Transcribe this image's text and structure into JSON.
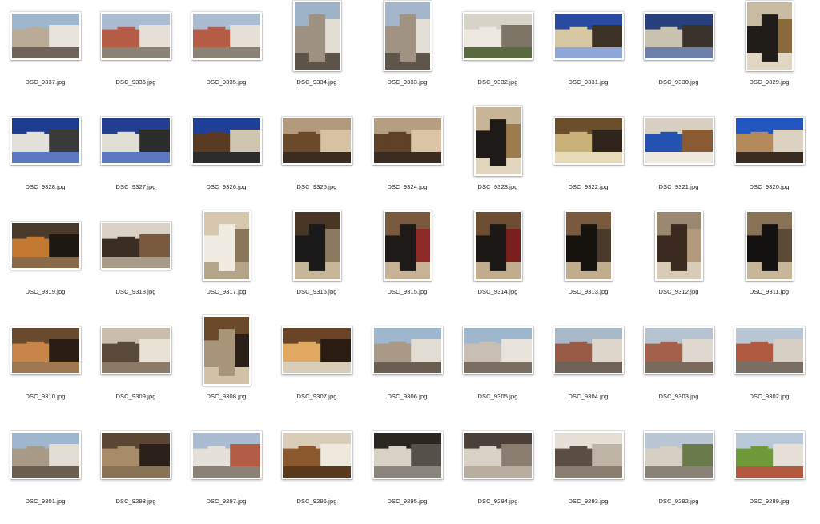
{
  "files": [
    {
      "name": "DSC_9337.jpg",
      "orientation": "landscape",
      "palette": [
        "#9fb6cf",
        "#b9ab95",
        "#e8e4dc",
        "#6e6459"
      ]
    },
    {
      "name": "DSC_9336.jpg",
      "orientation": "landscape",
      "palette": [
        "#a9bcd2",
        "#b45c45",
        "#e6e0d6",
        "#8b8276"
      ]
    },
    {
      "name": "DSC_9335.jpg",
      "orientation": "landscape",
      "palette": [
        "#a9bcd2",
        "#b45c45",
        "#e6e0d6",
        "#8b8276"
      ]
    },
    {
      "name": "DSC_9334.jpg",
      "orientation": "portrait",
      "palette": [
        "#9fb3c8",
        "#9d9181",
        "#e2ddd3",
        "#5c5349"
      ]
    },
    {
      "name": "DSC_9333.jpg",
      "orientation": "portrait",
      "palette": [
        "#a3b6cb",
        "#a09382",
        "#e4dfd6",
        "#5e554b"
      ]
    },
    {
      "name": "DSC_9332.jpg",
      "orientation": "landscape",
      "palette": [
        "#d8d3c8",
        "#ece8e0",
        "#7d7565",
        "#5a6b3f"
      ]
    },
    {
      "name": "DSC_9331.jpg",
      "orientation": "landscape",
      "palette": [
        "#2a4aa0",
        "#d7c7a2",
        "#3c3226",
        "#8fa6d6"
      ]
    },
    {
      "name": "DSC_9330.jpg",
      "orientation": "landscape",
      "palette": [
        "#28407e",
        "#c9c2b0",
        "#3a342c",
        "#6b7fa8"
      ]
    },
    {
      "name": "DSC_9329.jpg",
      "orientation": "portrait",
      "palette": [
        "#c9bba2",
        "#1f1c19",
        "#8a6a3a",
        "#e2d7c2"
      ]
    },
    {
      "name": "DSC_9328.jpg",
      "orientation": "landscape",
      "palette": [
        "#1e3d8f",
        "#e2e0d8",
        "#3a3a3a",
        "#5b78c0"
      ]
    },
    {
      "name": "DSC_9327.jpg",
      "orientation": "landscape",
      "palette": [
        "#22408f",
        "#e0ddd3",
        "#2c2c2c",
        "#5b78c0"
      ]
    },
    {
      "name": "DSC_9326.jpg",
      "orientation": "landscape",
      "palette": [
        "#1f4096",
        "#5a3b22",
        "#d0c6b0",
        "#2c2c2c"
      ]
    },
    {
      "name": "DSC_9325.jpg",
      "orientation": "landscape",
      "palette": [
        "#b49a7c",
        "#6a4a2a",
        "#d7c2a3",
        "#3a2c20"
      ]
    },
    {
      "name": "DSC_9324.jpg",
      "orientation": "landscape",
      "palette": [
        "#b69e80",
        "#5e4127",
        "#d9c4a6",
        "#3a2c20"
      ]
    },
    {
      "name": "DSC_9323.jpg",
      "orientation": "portrait",
      "palette": [
        "#c8b597",
        "#1d1a17",
        "#9c7b4e",
        "#e3d6bf"
      ]
    },
    {
      "name": "DSC_9322.jpg",
      "orientation": "landscape",
      "palette": [
        "#6b4f2c",
        "#c9b27a",
        "#2e241a",
        "#e8dcb8"
      ]
    },
    {
      "name": "DSC_9321.jpg",
      "orientation": "landscape",
      "palette": [
        "#d6cfc2",
        "#2452b0",
        "#8a5a33",
        "#ede9e1"
      ]
    },
    {
      "name": "DSC_9320.jpg",
      "orientation": "landscape",
      "palette": [
        "#2456c0",
        "#b48a5a",
        "#dbd2c2",
        "#3a2c20"
      ]
    },
    {
      "name": "DSC_9319.jpg",
      "orientation": "landscape",
      "palette": [
        "#4a3a2c",
        "#c27a33",
        "#1e1812",
        "#8a6a48"
      ]
    },
    {
      "name": "DSC_9318.jpg",
      "orientation": "landscape",
      "palette": [
        "#d8d1c4",
        "#3a2e24",
        "#7a5a3e",
        "#a89a86"
      ]
    },
    {
      "name": "DSC_9317.jpg",
      "orientation": "portrait",
      "palette": [
        "#d6c8ae",
        "#f1ece2",
        "#8a7658",
        "#b5a588"
      ]
    },
    {
      "name": "DSC_9316.jpg",
      "orientation": "portrait",
      "palette": [
        "#4a3624",
        "#1a1a1a",
        "#8c7a60",
        "#c9b79a"
      ]
    },
    {
      "name": "DSC_9315.jpg",
      "orientation": "portrait",
      "palette": [
        "#7a5a3e",
        "#1e1a18",
        "#8c2a2a",
        "#c7b295"
      ]
    },
    {
      "name": "DSC_9314.jpg",
      "orientation": "portrait",
      "palette": [
        "#6e4e32",
        "#1c1816",
        "#7a1e1e",
        "#c2ac8e"
      ]
    },
    {
      "name": "DSC_9313.jpg",
      "orientation": "portrait",
      "palette": [
        "#7a5a3e",
        "#16130f",
        "#4a3a2a",
        "#c2ac8e"
      ]
    },
    {
      "name": "DSC_9312.jpg",
      "orientation": "portrait",
      "palette": [
        "#9a8870",
        "#3a2a20",
        "#b49a7c",
        "#d9ccb6"
      ]
    },
    {
      "name": "DSC_9311.jpg",
      "orientation": "portrait",
      "palette": [
        "#8a7256",
        "#141210",
        "#5a4a36",
        "#c8b698"
      ]
    },
    {
      "name": "DSC_9310.jpg",
      "orientation": "landscape",
      "palette": [
        "#6a4a2e",
        "#c8854a",
        "#2a1e14",
        "#a07850"
      ]
    },
    {
      "name": "DSC_9309.jpg",
      "orientation": "landscape",
      "palette": [
        "#c9beac",
        "#5a4a3a",
        "#e8e2d6",
        "#8a7a66"
      ]
    },
    {
      "name": "DSC_9308.jpg",
      "orientation": "portrait",
      "palette": [
        "#6a4a2a",
        "#a8957a",
        "#2a2018",
        "#d2c3a6"
      ]
    },
    {
      "name": "DSC_9307.jpg",
      "orientation": "landscape",
      "palette": [
        "#6a4428",
        "#e0a860",
        "#2a1c12",
        "#d8cdb6"
      ]
    },
    {
      "name": "DSC_9306.jpg",
      "orientation": "landscape",
      "palette": [
        "#9fb6cf",
        "#a89a86",
        "#e2ddd3",
        "#6a5e50"
      ]
    },
    {
      "name": "DSC_9305.jpg",
      "orientation": "landscape",
      "palette": [
        "#9fb6cf",
        "#c6bfb2",
        "#e8e4dc",
        "#7a6e60"
      ]
    },
    {
      "name": "DSC_9304.jpg",
      "orientation": "landscape",
      "palette": [
        "#a7b8c9",
        "#9a5a48",
        "#ddd6ca",
        "#6e6256"
      ]
    },
    {
      "name": "DSC_9303.jpg",
      "orientation": "landscape",
      "palette": [
        "#b5c3d1",
        "#a4604a",
        "#ded8ce",
        "#7a6a5c"
      ]
    },
    {
      "name": "DSC_9302.jpg",
      "orientation": "landscape",
      "palette": [
        "#b9c6d3",
        "#b25a40",
        "#d6cfc4",
        "#7a6e62"
      ]
    },
    {
      "name": "DSC_9301.jpg",
      "orientation": "landscape",
      "palette": [
        "#9fb6cf",
        "#a89a86",
        "#e2ddd3",
        "#6a5e50"
      ]
    },
    {
      "name": "DSC_9298.jpg",
      "orientation": "landscape",
      "palette": [
        "#5a4632",
        "#a88c6a",
        "#2a2018",
        "#8a7256"
      ]
    },
    {
      "name": "DSC_9297.jpg",
      "orientation": "landscape",
      "palette": [
        "#a9bcd2",
        "#e6e1d8",
        "#b45c45",
        "#8a8276"
      ]
    },
    {
      "name": "DSC_9296.jpg",
      "orientation": "landscape",
      "palette": [
        "#d9cdb8",
        "#8a5a2e",
        "#efe8dc",
        "#5a3a1e"
      ]
    },
    {
      "name": "DSC_9295.jpg",
      "orientation": "landscape",
      "palette": [
        "#2a2620",
        "#d8d2c6",
        "#55504a",
        "#8a857c"
      ]
    },
    {
      "name": "DSC_9294.jpg",
      "orientation": "landscape",
      "palette": [
        "#4a4038",
        "#d8d2c6",
        "#8a7e70",
        "#b8aea0"
      ]
    },
    {
      "name": "DSC_9293.jpg",
      "orientation": "landscape",
      "palette": [
        "#e6e0d6",
        "#5a4e42",
        "#bdb4a6",
        "#8a7e70"
      ]
    },
    {
      "name": "DSC_9292.jpg",
      "orientation": "landscape",
      "palette": [
        "#b9c6d3",
        "#d6d0c4",
        "#6a7a4a",
        "#8a8276"
      ]
    },
    {
      "name": "DSC_9289.jpg",
      "orientation": "landscape",
      "palette": [
        "#b9c9d9",
        "#6f9a3a",
        "#e6e0d6",
        "#b25a40"
      ]
    }
  ]
}
